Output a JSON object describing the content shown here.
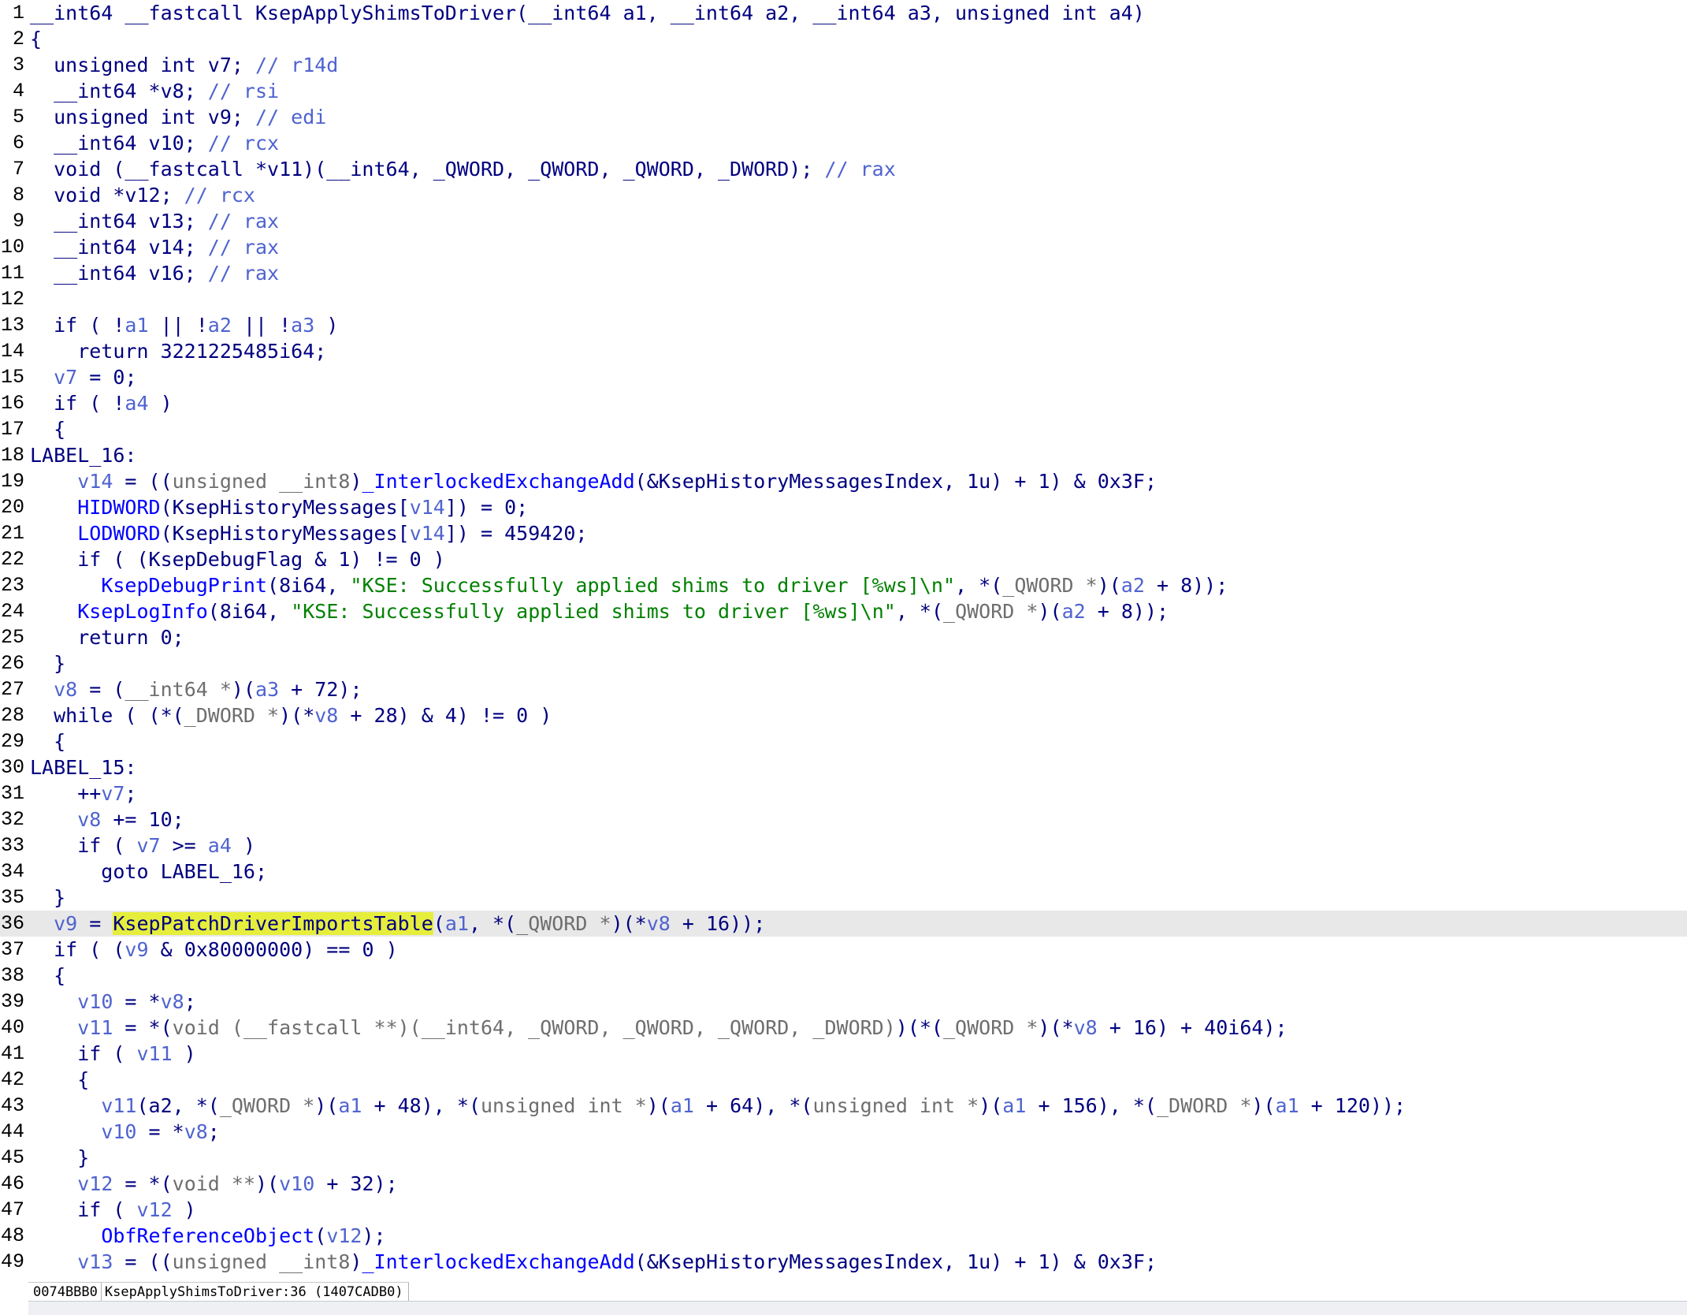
{
  "editor": {
    "current_line": 36,
    "lines": [
      [
        [
          "k",
          "__int64 __fastcall KsepApplyShimsToDriver(__int64 a1, __int64 a2, __int64 a3, unsigned int a4)"
        ]
      ],
      [
        [
          "p",
          "{"
        ]
      ],
      [
        [
          "k",
          "  unsigned int v7; "
        ],
        [
          "c",
          "// r14d"
        ]
      ],
      [
        [
          "k",
          "  __int64 *v8; "
        ],
        [
          "c",
          "// rsi"
        ]
      ],
      [
        [
          "k",
          "  unsigned int v9; "
        ],
        [
          "c",
          "// edi"
        ]
      ],
      [
        [
          "k",
          "  __int64 v10; "
        ],
        [
          "c",
          "// rcx"
        ]
      ],
      [
        [
          "k",
          "  void (__fastcall *v11)(__int64, _QWORD, _QWORD, _QWORD, _DWORD); "
        ],
        [
          "c",
          "// rax"
        ]
      ],
      [
        [
          "k",
          "  void *v12; "
        ],
        [
          "c",
          "// rcx"
        ]
      ],
      [
        [
          "k",
          "  __int64 v13; "
        ],
        [
          "c",
          "// rax"
        ]
      ],
      [
        [
          "k",
          "  __int64 v14; "
        ],
        [
          "c",
          "// rax"
        ]
      ],
      [
        [
          "k",
          "  __int64 v16; "
        ],
        [
          "c",
          "// rax"
        ]
      ],
      [
        [
          "p",
          ""
        ]
      ],
      [
        [
          "k",
          "  if ( !"
        ],
        [
          "v",
          "a1"
        ],
        [
          "k",
          " || !"
        ],
        [
          "v",
          "a2"
        ],
        [
          "k",
          " || !"
        ],
        [
          "v",
          "a3"
        ],
        [
          "k",
          " )"
        ]
      ],
      [
        [
          "k",
          "    return "
        ],
        [
          "n",
          "3221225485i64"
        ],
        [
          "p",
          ";"
        ]
      ],
      [
        [
          "p",
          "  "
        ],
        [
          "v",
          "v7"
        ],
        [
          "p",
          " = "
        ],
        [
          "n",
          "0"
        ],
        [
          "p",
          ";"
        ]
      ],
      [
        [
          "k",
          "  if ( !"
        ],
        [
          "v",
          "a4"
        ],
        [
          "k",
          " )"
        ]
      ],
      [
        [
          "p",
          "  {"
        ]
      ],
      [
        [
          "k",
          "LABEL_16:"
        ]
      ],
      [
        [
          "p",
          "    "
        ],
        [
          "v",
          "v14"
        ],
        [
          "p",
          " = (("
        ],
        [
          "t",
          "unsigned __int8"
        ],
        [
          "p",
          ")"
        ],
        [
          "f",
          "_InterlockedExchangeAdd"
        ],
        [
          "p",
          "(&"
        ],
        [
          "d",
          "KsepHistoryMessagesIndex"
        ],
        [
          "p",
          ", "
        ],
        [
          "n",
          "1u"
        ],
        [
          "p",
          ") + "
        ],
        [
          "n",
          "1"
        ],
        [
          "p",
          ") & "
        ],
        [
          "n",
          "0x3F"
        ],
        [
          "p",
          ";"
        ]
      ],
      [
        [
          "p",
          "    "
        ],
        [
          "f",
          "HIDWORD"
        ],
        [
          "p",
          "("
        ],
        [
          "d",
          "KsepHistoryMessages"
        ],
        [
          "p",
          "["
        ],
        [
          "v",
          "v14"
        ],
        [
          "p",
          "]) = "
        ],
        [
          "n",
          "0"
        ],
        [
          "p",
          ";"
        ]
      ],
      [
        [
          "p",
          "    "
        ],
        [
          "f",
          "LODWORD"
        ],
        [
          "p",
          "("
        ],
        [
          "d",
          "KsepHistoryMessages"
        ],
        [
          "p",
          "["
        ],
        [
          "v",
          "v14"
        ],
        [
          "p",
          "]) = "
        ],
        [
          "n",
          "459420"
        ],
        [
          "p",
          ";"
        ]
      ],
      [
        [
          "k",
          "    if ( ("
        ],
        [
          "d",
          "KsepDebugFlag"
        ],
        [
          "p",
          " & "
        ],
        [
          "n",
          "1"
        ],
        [
          "p",
          ") != "
        ],
        [
          "n",
          "0"
        ],
        [
          "k",
          " )"
        ]
      ],
      [
        [
          "p",
          "      "
        ],
        [
          "f",
          "KsepDebugPrint"
        ],
        [
          "p",
          "("
        ],
        [
          "n",
          "8i64"
        ],
        [
          "p",
          ", "
        ],
        [
          "s",
          "\"KSE: Successfully applied shims to driver [%ws]\\n\""
        ],
        [
          "p",
          ", *("
        ],
        [
          "t",
          "_QWORD *"
        ],
        [
          "p",
          ")("
        ],
        [
          "v",
          "a2"
        ],
        [
          "p",
          " + "
        ],
        [
          "n",
          "8"
        ],
        [
          "p",
          "));"
        ]
      ],
      [
        [
          "p",
          "    "
        ],
        [
          "f",
          "KsepLogInfo"
        ],
        [
          "p",
          "("
        ],
        [
          "n",
          "8i64"
        ],
        [
          "p",
          ", "
        ],
        [
          "s",
          "\"KSE: Successfully applied shims to driver [%ws]\\n\""
        ],
        [
          "p",
          ", *("
        ],
        [
          "t",
          "_QWORD *"
        ],
        [
          "p",
          ")("
        ],
        [
          "v",
          "a2"
        ],
        [
          "p",
          " + "
        ],
        [
          "n",
          "8"
        ],
        [
          "p",
          "));"
        ]
      ],
      [
        [
          "k",
          "    return "
        ],
        [
          "n",
          "0"
        ],
        [
          "p",
          ";"
        ]
      ],
      [
        [
          "p",
          "  }"
        ]
      ],
      [
        [
          "p",
          "  "
        ],
        [
          "v",
          "v8"
        ],
        [
          "p",
          " = ("
        ],
        [
          "t",
          "__int64 *"
        ],
        [
          "p",
          ")("
        ],
        [
          "v",
          "a3"
        ],
        [
          "p",
          " + "
        ],
        [
          "n",
          "72"
        ],
        [
          "p",
          ");"
        ]
      ],
      [
        [
          "k",
          "  while ( (*("
        ],
        [
          "t",
          "_DWORD *"
        ],
        [
          "p",
          ")(*"
        ],
        [
          "v",
          "v8"
        ],
        [
          "p",
          " + "
        ],
        [
          "n",
          "28"
        ],
        [
          "p",
          ") & "
        ],
        [
          "n",
          "4"
        ],
        [
          "p",
          ") != "
        ],
        [
          "n",
          "0"
        ],
        [
          "k",
          " )"
        ]
      ],
      [
        [
          "p",
          "  {"
        ]
      ],
      [
        [
          "k",
          "LABEL_15:"
        ]
      ],
      [
        [
          "p",
          "    ++"
        ],
        [
          "v",
          "v7"
        ],
        [
          "p",
          ";"
        ]
      ],
      [
        [
          "p",
          "    "
        ],
        [
          "v",
          "v8"
        ],
        [
          "p",
          " += "
        ],
        [
          "n",
          "10"
        ],
        [
          "p",
          ";"
        ]
      ],
      [
        [
          "k",
          "    if ( "
        ],
        [
          "v",
          "v7"
        ],
        [
          "p",
          " >= "
        ],
        [
          "v",
          "a4"
        ],
        [
          "k",
          " )"
        ]
      ],
      [
        [
          "k",
          "      goto LABEL_16;"
        ]
      ],
      [
        [
          "p",
          "  }"
        ]
      ],
      [
        [
          "p",
          "  "
        ],
        [
          "v",
          "v9"
        ],
        [
          "p",
          " = "
        ],
        [
          "h",
          "KsepPatchDriverImportsTable"
        ],
        [
          "p",
          "("
        ],
        [
          "v",
          "a1"
        ],
        [
          "p",
          ", *("
        ],
        [
          "t",
          "_QWORD *"
        ],
        [
          "p",
          ")(*"
        ],
        [
          "v",
          "v8"
        ],
        [
          "p",
          " + "
        ],
        [
          "n",
          "16"
        ],
        [
          "p",
          "));"
        ]
      ],
      [
        [
          "k",
          "  if ( ("
        ],
        [
          "v",
          "v9"
        ],
        [
          "p",
          " & "
        ],
        [
          "n",
          "0x80000000"
        ],
        [
          "p",
          ") == "
        ],
        [
          "n",
          "0"
        ],
        [
          "k",
          " )"
        ]
      ],
      [
        [
          "p",
          "  {"
        ]
      ],
      [
        [
          "p",
          "    "
        ],
        [
          "v",
          "v10"
        ],
        [
          "p",
          " = *"
        ],
        [
          "v",
          "v8"
        ],
        [
          "p",
          ";"
        ]
      ],
      [
        [
          "p",
          "    "
        ],
        [
          "v",
          "v11"
        ],
        [
          "p",
          " = *("
        ],
        [
          "t",
          "void (__fastcall **)(__int64, _QWORD, _QWORD, _QWORD, _DWORD)"
        ],
        [
          "p",
          ")(*("
        ],
        [
          "t",
          "_QWORD *"
        ],
        [
          "p",
          ")(*"
        ],
        [
          "v",
          "v8"
        ],
        [
          "p",
          " + "
        ],
        [
          "n",
          "16"
        ],
        [
          "p",
          ") + "
        ],
        [
          "n",
          "40i64"
        ],
        [
          "p",
          ");"
        ]
      ],
      [
        [
          "k",
          "    if ( "
        ],
        [
          "v",
          "v11"
        ],
        [
          "k",
          " )"
        ]
      ],
      [
        [
          "p",
          "    {"
        ]
      ],
      [
        [
          "p",
          "      "
        ],
        [
          "v",
          "v11"
        ],
        [
          "p",
          "(a2, *("
        ],
        [
          "t",
          "_QWORD *"
        ],
        [
          "p",
          ")("
        ],
        [
          "v",
          "a1"
        ],
        [
          "p",
          " + "
        ],
        [
          "n",
          "48"
        ],
        [
          "p",
          "), *("
        ],
        [
          "t",
          "unsigned int *"
        ],
        [
          "p",
          ")("
        ],
        [
          "v",
          "a1"
        ],
        [
          "p",
          " + "
        ],
        [
          "n",
          "64"
        ],
        [
          "p",
          "), *("
        ],
        [
          "t",
          "unsigned int *"
        ],
        [
          "p",
          ")("
        ],
        [
          "v",
          "a1"
        ],
        [
          "p",
          " + "
        ],
        [
          "n",
          "156"
        ],
        [
          "p",
          "), *("
        ],
        [
          "t",
          "_DWORD *"
        ],
        [
          "p",
          ")("
        ],
        [
          "v",
          "a1"
        ],
        [
          "p",
          " + "
        ],
        [
          "n",
          "120"
        ],
        [
          "p",
          "));"
        ]
      ],
      [
        [
          "p",
          "      "
        ],
        [
          "v",
          "v10"
        ],
        [
          "p",
          " = *"
        ],
        [
          "v",
          "v8"
        ],
        [
          "p",
          ";"
        ]
      ],
      [
        [
          "p",
          "    }"
        ]
      ],
      [
        [
          "p",
          "    "
        ],
        [
          "v",
          "v12"
        ],
        [
          "p",
          " = *("
        ],
        [
          "t",
          "void **"
        ],
        [
          "p",
          ")("
        ],
        [
          "v",
          "v10"
        ],
        [
          "p",
          " + "
        ],
        [
          "n",
          "32"
        ],
        [
          "p",
          ");"
        ]
      ],
      [
        [
          "k",
          "    if ( "
        ],
        [
          "v",
          "v12"
        ],
        [
          "k",
          " )"
        ]
      ],
      [
        [
          "p",
          "      "
        ],
        [
          "f",
          "ObfReferenceObject"
        ],
        [
          "p",
          "("
        ],
        [
          "v",
          "v12"
        ],
        [
          "p",
          ");"
        ]
      ],
      [
        [
          "p",
          "    "
        ],
        [
          "v",
          "v13"
        ],
        [
          "p",
          " = (("
        ],
        [
          "t",
          "unsigned __int8"
        ],
        [
          "p",
          ")"
        ],
        [
          "f",
          "_InterlockedExchangeAdd"
        ],
        [
          "p",
          "(&"
        ],
        [
          "d",
          "KsepHistoryMessagesIndex"
        ],
        [
          "p",
          ", "
        ],
        [
          "n",
          "1u"
        ],
        [
          "p",
          ") + "
        ],
        [
          "n",
          "1"
        ],
        [
          "p",
          ") & "
        ],
        [
          "n",
          "0x3F"
        ],
        [
          "p",
          ";"
        ]
      ]
    ]
  },
  "status_bar": {
    "address": "0074BBB0",
    "location": "KsepApplyShimsToDriver:36 (1407CADB0)"
  }
}
